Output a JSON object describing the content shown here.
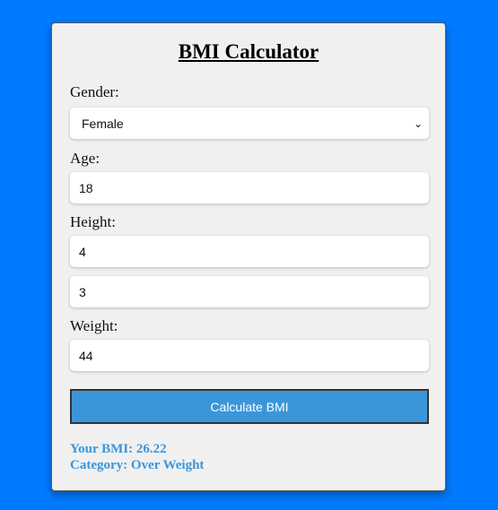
{
  "title": "BMI Calculator",
  "gender": {
    "label": "Gender:",
    "selected": "Female"
  },
  "age": {
    "label": "Age:",
    "value": "18"
  },
  "height": {
    "label": "Height:",
    "feet": "4",
    "inches": "3"
  },
  "weight": {
    "label": "Weight:",
    "value": "44"
  },
  "button": {
    "label": "Calculate BMI"
  },
  "result": {
    "bmi": "Your BMI: 26.22",
    "category": "Category: Over Weight"
  },
  "colors": {
    "page_background": "#007bff",
    "card_background": "#f0f0f0",
    "accent": "#3b96d9"
  },
  "icons": {
    "select_arrow": "chevron-down-icon"
  }
}
